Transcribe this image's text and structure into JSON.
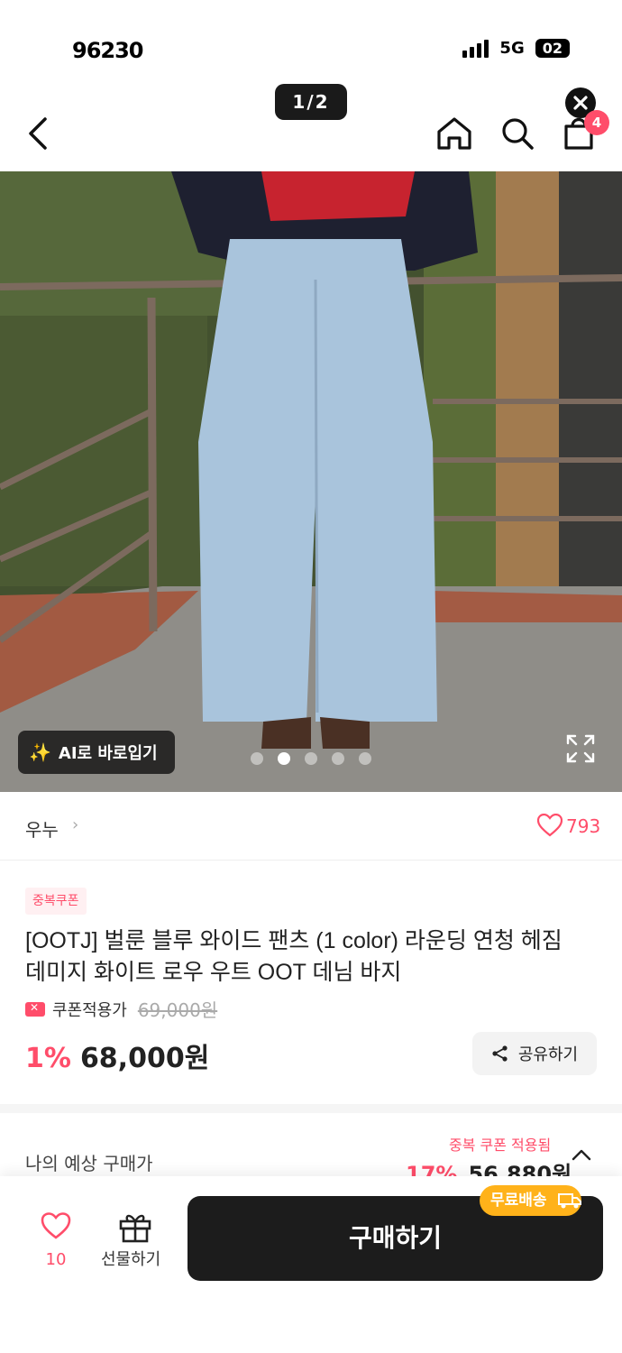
{
  "status_bar": {
    "time": "96230",
    "network": "5G",
    "battery": "02"
  },
  "header": {
    "page_indicator": "1/2",
    "cart_count": "4"
  },
  "photo": {
    "ai_button_label": "AI로 바로입기",
    "dots": 5,
    "active_dot": 2
  },
  "brand": {
    "name": "우누",
    "chevron": "›",
    "likes": "793"
  },
  "product": {
    "coupon_tag": "중복쿠폰",
    "title": "[OOTJ] 벌룬 블루 와이드 팬츠 (1 color) 라운딩 연청 헤짐 데미지 화이트 로우 우트 OOT 데님 바지",
    "coupon_label": "쿠폰적용가",
    "original_price": "69,000원",
    "discount": "1%",
    "price": "68,000원",
    "share_label": "공유하기"
  },
  "expected": {
    "label": "나의 예상 구매가",
    "coupon_note": "중복 쿠폰 적용됨",
    "discount": "17%",
    "price": "56,880원"
  },
  "bottom": {
    "wish_count": "10",
    "gift_label": "선물하기",
    "buy_label": "구매하기",
    "free_shipping": "무료배송"
  },
  "colors": {
    "accent": "#ff4d6a",
    "buy_button": "#1c1c1c",
    "free_ship": "#ffb21a"
  },
  "icons": [
    "back-icon",
    "home-icon",
    "search-icon",
    "bag-icon",
    "close-icon",
    "wand-icon",
    "expand-icon",
    "heart-icon",
    "gift-icon",
    "share-icon",
    "chevron-up-icon",
    "truck-icon",
    "coupon-icon"
  ]
}
